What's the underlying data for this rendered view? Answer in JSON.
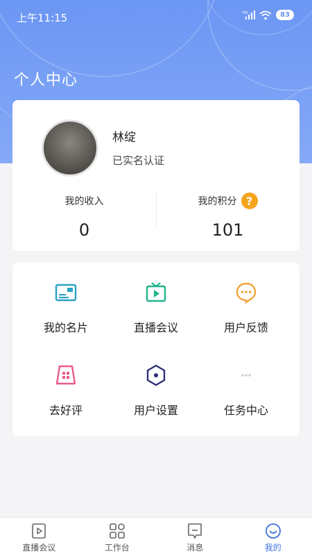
{
  "status_bar": {
    "time": "上午11:15",
    "network": "HD",
    "battery": "83"
  },
  "page_title": "个人中心",
  "profile": {
    "name": "林绽",
    "verify_status": "已实名认证",
    "income_label": "我的收入",
    "income_value": "0",
    "points_label": "我的积分",
    "points_value": "101"
  },
  "menu": {
    "items": [
      {
        "label": "我的名片",
        "icon": "business-card-icon",
        "color": "#2aa3c5"
      },
      {
        "label": "直播会议",
        "icon": "live-tv-icon",
        "color": "#20b58c"
      },
      {
        "label": "用户反馈",
        "icon": "chat-bubble-icon",
        "color": "#f0a23a"
      },
      {
        "label": "去好评",
        "icon": "rating-store-icon",
        "color": "#e85a8b"
      },
      {
        "label": "用户设置",
        "icon": "hexagon-settings-icon",
        "color": "#2f2f7a"
      },
      {
        "label": "任务中心",
        "icon": "more-dots-icon",
        "color": "#c8c8c8"
      }
    ]
  },
  "tab_bar": {
    "tabs": [
      {
        "label": "直播会议",
        "icon": "play-icon"
      },
      {
        "label": "工作台",
        "icon": "grid-icon"
      },
      {
        "label": "消息",
        "icon": "message-icon"
      },
      {
        "label": "我的",
        "icon": "smile-icon",
        "active": true
      }
    ]
  },
  "colors": {
    "header": "#6b96f3",
    "accent": "#3d72dc",
    "help": "#f4a41c"
  }
}
